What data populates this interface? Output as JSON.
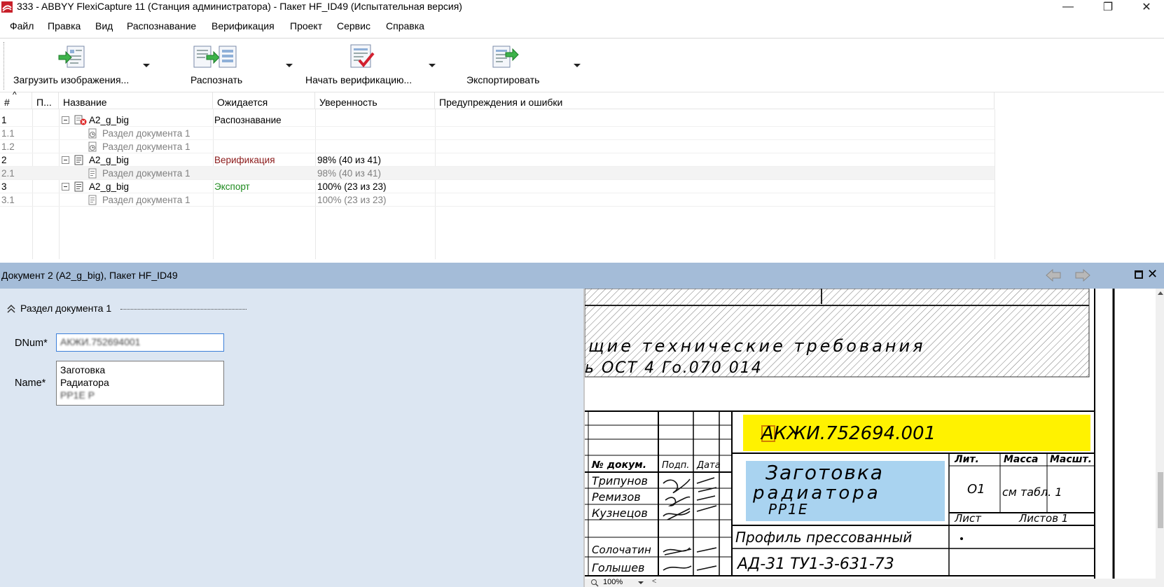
{
  "window": {
    "title": "333 - ABBYY FlexiCapture 11 (Станция администратора) - Пакет HF_ID49 (Испытательная версия)",
    "controls": {
      "minimize": "—",
      "restore": "❐",
      "close": "✕"
    }
  },
  "menu": [
    "Файл",
    "Правка",
    "Вид",
    "Распознавание",
    "Верификация",
    "Проект",
    "Сервис",
    "Справка"
  ],
  "toolbar": {
    "load": "Загрузить изображения...",
    "recognize": "Распознать",
    "verify": "Начать верификацию...",
    "export": "Экспортировать"
  },
  "grid": {
    "columns": [
      "#",
      "П...",
      "Название",
      "Ожидается",
      "Уверенность",
      "Предупреждения и ошибки"
    ],
    "sort_indicator": "^",
    "rows": [
      {
        "num": "1",
        "name": "A2_g_big",
        "expected": "Распознавание",
        "confidence": ""
      },
      {
        "num": "1.1",
        "name": "Раздел документа 1",
        "expected": "",
        "confidence": ""
      },
      {
        "num": "1.2",
        "name": "Раздел документа 1",
        "expected": "",
        "confidence": ""
      },
      {
        "num": "2",
        "name": "A2_g_big",
        "expected": "Верификация",
        "confidence": "98% (40 из 41)"
      },
      {
        "num": "2.1",
        "name": "Раздел документа 1",
        "expected": "",
        "confidence": "98% (40 из 41)"
      },
      {
        "num": "3",
        "name": "A2_g_big",
        "expected": "Экспорт",
        "confidence": "100% (23 из 23)"
      },
      {
        "num": "3.1",
        "name": "Раздел документа 1",
        "expected": "",
        "confidence": "100% (23 из 23)"
      }
    ]
  },
  "panel": {
    "title": "Документ 2 (A2_g_big), Пакет HF_ID49"
  },
  "form": {
    "section": "Раздел документа 1",
    "dnum_label": "DNum*",
    "dnum_value": "АКЖИ.752694001",
    "name_label": "Name*",
    "name_lines": [
      "Заготовка",
      "Радиатора",
      "РР1Е Р"
    ]
  },
  "viewer": {
    "zoom": "100%",
    "drawing": {
      "tech_line1": "щие технические требования",
      "tech_line2": "ь ОСТ 4 Го.070 014",
      "doc_code": "АКЖИ.752694.001",
      "title_line1": "Заготовка",
      "title_line2": "радиатора",
      "title_line3": "РР1Е",
      "profile": "Профиль прессованный",
      "material": "АД-31 ТУ1-3-631-73",
      "col_doc": "№ докум.",
      "col_sign": "Подп.",
      "col_date": "Дата",
      "names": [
        "Трипунов",
        "Ремизов",
        "Кузнецов",
        "Солочатин",
        "Голышев"
      ],
      "lit": "Лит.",
      "mass": "Масса",
      "scale": "Масшт.",
      "lit_val": "О1",
      "mass_val": "см табл. 1",
      "sheet": "Лист",
      "sheets": "Листов 1"
    }
  },
  "colors": {
    "verification": "#8b1a1a",
    "export": "#1e8a1e",
    "panel_header": "#a4bcd8",
    "form_bg": "#dce6f2",
    "highlight_yellow": "#fff200",
    "highlight_blue": "#a9d3f0"
  }
}
